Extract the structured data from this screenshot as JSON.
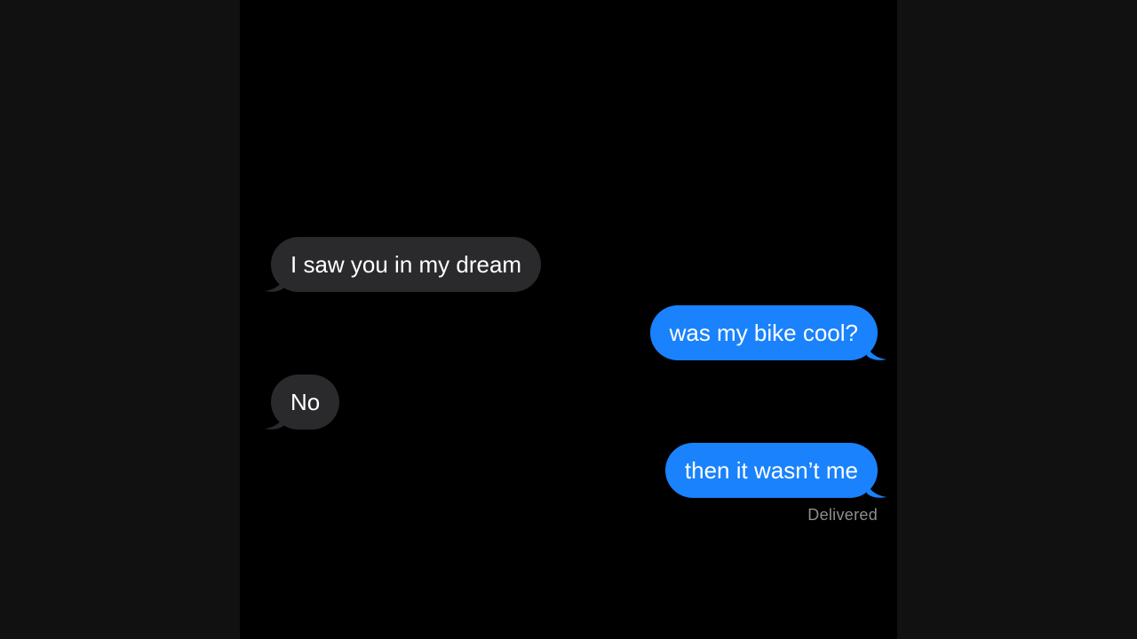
{
  "conversation": {
    "messages": [
      {
        "direction": "received",
        "text": "I saw you in my dream"
      },
      {
        "direction": "sent",
        "text": "was my bike cool?"
      },
      {
        "direction": "received",
        "text": "No"
      },
      {
        "direction": "sent",
        "text": "then it wasn’t me"
      }
    ],
    "status": "Delivered"
  },
  "colors": {
    "background": "#000000",
    "outer_background": "#111111",
    "received_bubble": "#2a2a2c",
    "sent_bubble": "#1982fc",
    "text": "#ffffff",
    "status_text": "#8e8e93"
  }
}
